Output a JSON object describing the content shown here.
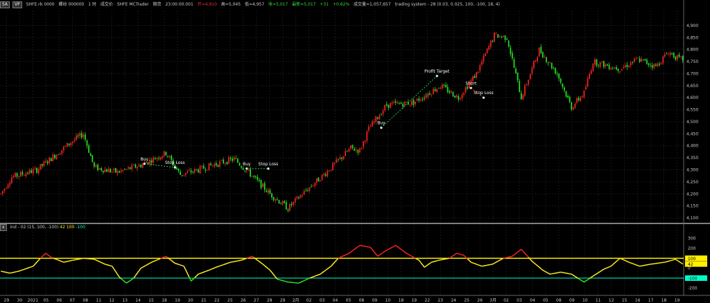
{
  "header": {
    "btn_1": "SA",
    "btn_2": "VP",
    "symbol": "SHFE.rb 0000",
    "misc_1": "螺纹 000000",
    "misc_2": "1 时",
    "misc_3": "成交价",
    "source": "SHFE  MCTrader",
    "period_label": "期货",
    "time": "23:00:00.001",
    "open": "开=4,910",
    "high": "高=5,045",
    "low": "低=4,957",
    "close": "收=5,017",
    "last": "最新=5,017",
    "change": "+31",
    "change_pct": "+0.62%",
    "volume": "成交量=1,057,657",
    "strategy": "trading system - 28 (0.03,  0.025,  100,  -100,  18,  4)"
  },
  "indicator_header": {
    "icon_label": "x",
    "name": "ind - 02",
    "params": "(15,  100,  -100)",
    "value_1": "42",
    "value_2": "100",
    "value_3": "-100"
  },
  "colors": {
    "up": "#ee2222",
    "down": "#22dd22",
    "ind_line": "#ffee22",
    "ind_up": "#ff2222",
    "ind_down": "#22ee22",
    "hline_top": "#ffee00",
    "hline_bottom": "#00ffcc",
    "grid": "#2a2a2a",
    "separator": "#ffffff",
    "signal": "#ffffff"
  },
  "chart_data": [
    {
      "type": "candlestick",
      "title": "SHFE.rb 0000",
      "ylim": [
        4080,
        4960
      ],
      "y_ticks": [
        "4,900",
        "4,850",
        "4,800",
        "4,750",
        "4,700",
        "4,650",
        "4,600",
        "4,550",
        "4,500",
        "4,450",
        "4,400",
        "4,350",
        "4,300",
        "4,250",
        "4,200",
        "4,150",
        "4,100"
      ],
      "y_tick_values": [
        4900,
        4850,
        4800,
        4750,
        4700,
        4650,
        4600,
        4550,
        4500,
        4450,
        4400,
        4350,
        4300,
        4250,
        4200,
        4150,
        4100
      ],
      "x_ticks": [
        "29",
        "30",
        "2021",
        "05",
        "06",
        "07",
        "08",
        "11",
        "12",
        "13",
        "14",
        "15",
        "18",
        "19",
        "20",
        "21",
        "22",
        "25",
        "26",
        "27",
        "28",
        "29",
        "2月",
        "02",
        "03",
        "04",
        "05",
        "08",
        "09",
        "10",
        "18",
        "19",
        "22",
        "23",
        "24",
        "25",
        "26",
        "3月",
        "02",
        "03",
        "04",
        "05",
        "08",
        "09",
        "10",
        "11",
        "12",
        "15",
        "16",
        "17",
        "18",
        "19"
      ],
      "price_anchors": [
        [
          0,
          4200
        ],
        [
          6,
          4270
        ],
        [
          20,
          4300
        ],
        [
          40,
          4420
        ],
        [
          46,
          4450
        ],
        [
          52,
          4310
        ],
        [
          65,
          4290
        ],
        [
          78,
          4320
        ],
        [
          92,
          4370
        ],
        [
          100,
          4280
        ],
        [
          110,
          4300
        ],
        [
          118,
          4320
        ],
        [
          130,
          4345
        ],
        [
          138,
          4290
        ],
        [
          150,
          4200
        ],
        [
          160,
          4140
        ],
        [
          168,
          4200
        ],
        [
          180,
          4280
        ],
        [
          195,
          4390
        ],
        [
          200,
          4380
        ],
        [
          205,
          4470
        ],
        [
          215,
          4570
        ],
        [
          230,
          4580
        ],
        [
          245,
          4650
        ],
        [
          255,
          4600
        ],
        [
          265,
          4700
        ],
        [
          275,
          4860
        ],
        [
          282,
          4850
        ],
        [
          290,
          4600
        ],
        [
          300,
          4800
        ],
        [
          310,
          4700
        ],
        [
          318,
          4560
        ],
        [
          325,
          4620
        ],
        [
          330,
          4750
        ],
        [
          345,
          4720
        ],
        [
          355,
          4760
        ],
        [
          365,
          4730
        ],
        [
          372,
          4790
        ],
        [
          378,
          4760
        ]
      ],
      "signals": [
        {
          "label": "Buy",
          "x": 80,
          "price": 4325,
          "arrow": "up"
        },
        {
          "label": "Stop Loss",
          "x": 97,
          "price": 4310,
          "arrow": "down"
        },
        {
          "label": "Buy",
          "x": 137,
          "price": 4305,
          "arrow": "up"
        },
        {
          "label": "Stop Loss",
          "x": 149,
          "price": 4305,
          "arrow": "down"
        },
        {
          "label": "Buy",
          "x": 212,
          "price": 4475,
          "arrow": "up"
        },
        {
          "label": "Profit Target",
          "x": 243,
          "price": 4690,
          "arrow": "up"
        },
        {
          "label": "Short",
          "x": 262,
          "price": 4640,
          "arrow": "down"
        },
        {
          "label": "Stop Loss",
          "x": 269,
          "price": 4600,
          "arrow": "down"
        }
      ]
    },
    {
      "type": "line",
      "title": "ind - 02",
      "ylim": [
        -260,
        360
      ],
      "y_ticks": [
        "300",
        "200",
        "100",
        "0",
        "-100",
        "-200"
      ],
      "y_tick_values": [
        300,
        200,
        100,
        0,
        -100,
        -200
      ],
      "hlines": [
        100,
        -100
      ],
      "value_labels": [
        "100",
        "42",
        "-100"
      ],
      "value_label_values": [
        100,
        42,
        -100
      ],
      "series": [
        {
          "anchors": [
            [
              0,
              -30
            ],
            [
              5,
              -50
            ],
            [
              10,
              -30
            ],
            [
              18,
              20
            ],
            [
              22,
              100
            ],
            [
              25,
              150
            ],
            [
              28,
              110
            ],
            [
              35,
              60
            ],
            [
              40,
              80
            ],
            [
              46,
              100
            ],
            [
              52,
              90
            ],
            [
              58,
              40
            ],
            [
              62,
              20
            ],
            [
              66,
              -90
            ],
            [
              70,
              -150
            ],
            [
              74,
              -100
            ],
            [
              78,
              0
            ],
            [
              84,
              60
            ],
            [
              92,
              120
            ],
            [
              97,
              50
            ],
            [
              102,
              20
            ],
            [
              106,
              -130
            ],
            [
              110,
              -60
            ],
            [
              116,
              -20
            ],
            [
              120,
              10
            ],
            [
              128,
              60
            ],
            [
              134,
              80
            ],
            [
              140,
              120
            ],
            [
              146,
              40
            ],
            [
              150,
              -20
            ],
            [
              154,
              -110
            ],
            [
              160,
              -140
            ],
            [
              166,
              -150
            ],
            [
              172,
              -100
            ],
            [
              178,
              -60
            ],
            [
              184,
              20
            ],
            [
              188,
              100
            ],
            [
              194,
              150
            ],
            [
              200,
              230
            ],
            [
              206,
              210
            ],
            [
              210,
              120
            ],
            [
              214,
              170
            ],
            [
              220,
              230
            ],
            [
              226,
              150
            ],
            [
              230,
              110
            ],
            [
              233,
              80
            ],
            [
              236,
              10
            ],
            [
              240,
              60
            ],
            [
              244,
              80
            ],
            [
              250,
              100
            ],
            [
              254,
              150
            ],
            [
              258,
              130
            ],
            [
              262,
              60
            ],
            [
              268,
              20
            ],
            [
              274,
              40
            ],
            [
              280,
              100
            ],
            [
              285,
              120
            ],
            [
              290,
              190
            ],
            [
              296,
              70
            ],
            [
              302,
              -20
            ],
            [
              306,
              -60
            ],
            [
              312,
              -40
            ],
            [
              318,
              -60
            ],
            [
              325,
              -140
            ],
            [
              330,
              -80
            ],
            [
              336,
              -10
            ],
            [
              340,
              20
            ],
            [
              345,
              100
            ],
            [
              350,
              60
            ],
            [
              356,
              20
            ],
            [
              362,
              40
            ],
            [
              370,
              60
            ],
            [
              376,
              90
            ],
            [
              380,
              42
            ]
          ]
        }
      ]
    }
  ]
}
